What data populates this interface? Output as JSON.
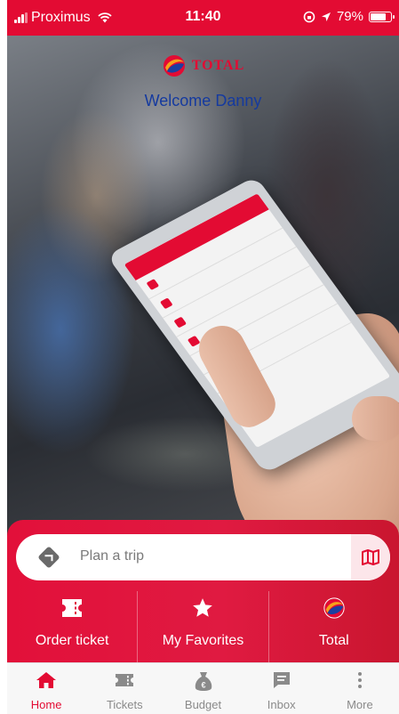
{
  "status_bar": {
    "carrier": "Proximus",
    "time": "11:40",
    "battery_percent": "79%",
    "battery_level": 0.79
  },
  "header": {
    "brand": "TOTAL",
    "welcome": "Welcome Danny"
  },
  "search": {
    "placeholder": "Plan a trip",
    "icon": "directions-icon",
    "map_icon": "map-icon"
  },
  "actions": [
    {
      "label": "Order ticket",
      "icon": "ticket-icon"
    },
    {
      "label": "My Favorites",
      "icon": "star-icon"
    },
    {
      "label": "Total",
      "icon": "total-logo-icon"
    }
  ],
  "tabs": [
    {
      "label": "Home",
      "icon": "home-icon",
      "active": true
    },
    {
      "label": "Tickets",
      "icon": "tickets-icon",
      "active": false
    },
    {
      "label": "Budget",
      "icon": "money-bag-icon",
      "active": false
    },
    {
      "label": "Inbox",
      "icon": "inbox-icon",
      "active": false
    },
    {
      "label": "More",
      "icon": "more-icon",
      "active": false
    }
  ],
  "colors": {
    "brand_red": "#e30b33",
    "welcome_blue": "#153a9f",
    "tab_inactive": "#8a8a8a"
  }
}
